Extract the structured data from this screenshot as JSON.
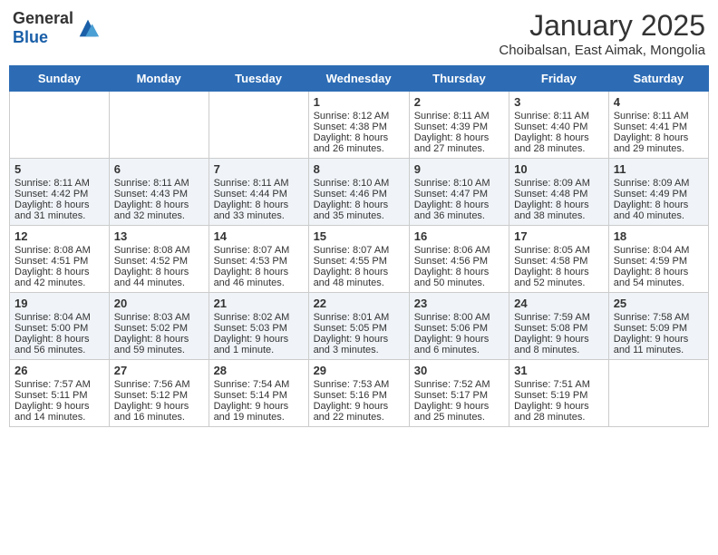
{
  "header": {
    "logo_general": "General",
    "logo_blue": "Blue",
    "month": "January 2025",
    "location": "Choibalsan, East Aimak, Mongolia"
  },
  "days_of_week": [
    "Sunday",
    "Monday",
    "Tuesday",
    "Wednesday",
    "Thursday",
    "Friday",
    "Saturday"
  ],
  "weeks": [
    [
      {
        "day": "",
        "text": ""
      },
      {
        "day": "",
        "text": ""
      },
      {
        "day": "",
        "text": ""
      },
      {
        "day": "1",
        "text": "Sunrise: 8:12 AM\nSunset: 4:38 PM\nDaylight: 8 hours and 26 minutes."
      },
      {
        "day": "2",
        "text": "Sunrise: 8:11 AM\nSunset: 4:39 PM\nDaylight: 8 hours and 27 minutes."
      },
      {
        "day": "3",
        "text": "Sunrise: 8:11 AM\nSunset: 4:40 PM\nDaylight: 8 hours and 28 minutes."
      },
      {
        "day": "4",
        "text": "Sunrise: 8:11 AM\nSunset: 4:41 PM\nDaylight: 8 hours and 29 minutes."
      }
    ],
    [
      {
        "day": "5",
        "text": "Sunrise: 8:11 AM\nSunset: 4:42 PM\nDaylight: 8 hours and 31 minutes."
      },
      {
        "day": "6",
        "text": "Sunrise: 8:11 AM\nSunset: 4:43 PM\nDaylight: 8 hours and 32 minutes."
      },
      {
        "day": "7",
        "text": "Sunrise: 8:11 AM\nSunset: 4:44 PM\nDaylight: 8 hours and 33 minutes."
      },
      {
        "day": "8",
        "text": "Sunrise: 8:10 AM\nSunset: 4:46 PM\nDaylight: 8 hours and 35 minutes."
      },
      {
        "day": "9",
        "text": "Sunrise: 8:10 AM\nSunset: 4:47 PM\nDaylight: 8 hours and 36 minutes."
      },
      {
        "day": "10",
        "text": "Sunrise: 8:09 AM\nSunset: 4:48 PM\nDaylight: 8 hours and 38 minutes."
      },
      {
        "day": "11",
        "text": "Sunrise: 8:09 AM\nSunset: 4:49 PM\nDaylight: 8 hours and 40 minutes."
      }
    ],
    [
      {
        "day": "12",
        "text": "Sunrise: 8:08 AM\nSunset: 4:51 PM\nDaylight: 8 hours and 42 minutes."
      },
      {
        "day": "13",
        "text": "Sunrise: 8:08 AM\nSunset: 4:52 PM\nDaylight: 8 hours and 44 minutes."
      },
      {
        "day": "14",
        "text": "Sunrise: 8:07 AM\nSunset: 4:53 PM\nDaylight: 8 hours and 46 minutes."
      },
      {
        "day": "15",
        "text": "Sunrise: 8:07 AM\nSunset: 4:55 PM\nDaylight: 8 hours and 48 minutes."
      },
      {
        "day": "16",
        "text": "Sunrise: 8:06 AM\nSunset: 4:56 PM\nDaylight: 8 hours and 50 minutes."
      },
      {
        "day": "17",
        "text": "Sunrise: 8:05 AM\nSunset: 4:58 PM\nDaylight: 8 hours and 52 minutes."
      },
      {
        "day": "18",
        "text": "Sunrise: 8:04 AM\nSunset: 4:59 PM\nDaylight: 8 hours and 54 minutes."
      }
    ],
    [
      {
        "day": "19",
        "text": "Sunrise: 8:04 AM\nSunset: 5:00 PM\nDaylight: 8 hours and 56 minutes."
      },
      {
        "day": "20",
        "text": "Sunrise: 8:03 AM\nSunset: 5:02 PM\nDaylight: 8 hours and 59 minutes."
      },
      {
        "day": "21",
        "text": "Sunrise: 8:02 AM\nSunset: 5:03 PM\nDaylight: 9 hours and 1 minute."
      },
      {
        "day": "22",
        "text": "Sunrise: 8:01 AM\nSunset: 5:05 PM\nDaylight: 9 hours and 3 minutes."
      },
      {
        "day": "23",
        "text": "Sunrise: 8:00 AM\nSunset: 5:06 PM\nDaylight: 9 hours and 6 minutes."
      },
      {
        "day": "24",
        "text": "Sunrise: 7:59 AM\nSunset: 5:08 PM\nDaylight: 9 hours and 8 minutes."
      },
      {
        "day": "25",
        "text": "Sunrise: 7:58 AM\nSunset: 5:09 PM\nDaylight: 9 hours and 11 minutes."
      }
    ],
    [
      {
        "day": "26",
        "text": "Sunrise: 7:57 AM\nSunset: 5:11 PM\nDaylight: 9 hours and 14 minutes."
      },
      {
        "day": "27",
        "text": "Sunrise: 7:56 AM\nSunset: 5:12 PM\nDaylight: 9 hours and 16 minutes."
      },
      {
        "day": "28",
        "text": "Sunrise: 7:54 AM\nSunset: 5:14 PM\nDaylight: 9 hours and 19 minutes."
      },
      {
        "day": "29",
        "text": "Sunrise: 7:53 AM\nSunset: 5:16 PM\nDaylight: 9 hours and 22 minutes."
      },
      {
        "day": "30",
        "text": "Sunrise: 7:52 AM\nSunset: 5:17 PM\nDaylight: 9 hours and 25 minutes."
      },
      {
        "day": "31",
        "text": "Sunrise: 7:51 AM\nSunset: 5:19 PM\nDaylight: 9 hours and 28 minutes."
      },
      {
        "day": "",
        "text": ""
      }
    ]
  ]
}
